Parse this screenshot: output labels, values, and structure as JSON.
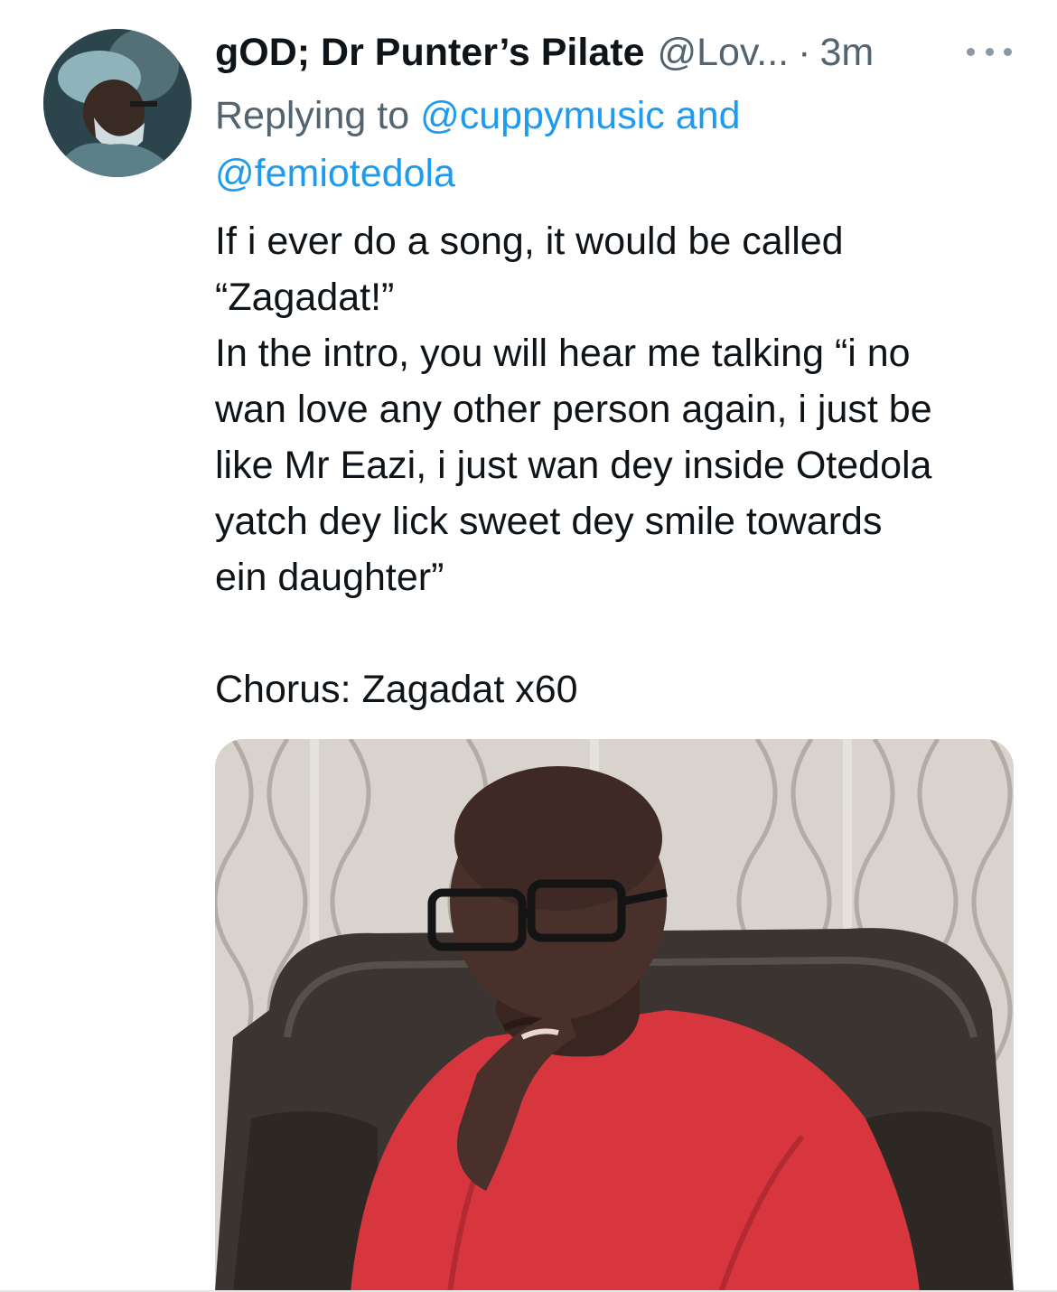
{
  "tweet": {
    "display_name": "gOD; Dr Punter’s Pilate",
    "handle": "@Lov...",
    "separator": "·",
    "timestamp": "3m",
    "more_icon": "more-horizontal-icon",
    "replying": {
      "prefix": "Replying to",
      "mention_1": "@cuppymusic",
      "and_word": "and",
      "mention_2": "@femiotedola"
    },
    "text": "If i ever do a song, it would be called\n“Zagadat!”\nIn the intro, you will hear me talking “i no\nwan love any other person again, i just be\nlike Mr Eazi, i just wan dey inside Otedola\nyatch dey lick sweet dey smile towards\nein daughter”\n\nChorus: Zagadat x60",
    "avatar_icon": "surgeon-avatar-icon",
    "media_icon": "man-in-red-shirt-photo-icon"
  },
  "colors": {
    "text_primary": "#0f1419",
    "text_secondary": "#536471",
    "link": "#1d9bf0",
    "background": "#ffffff"
  }
}
